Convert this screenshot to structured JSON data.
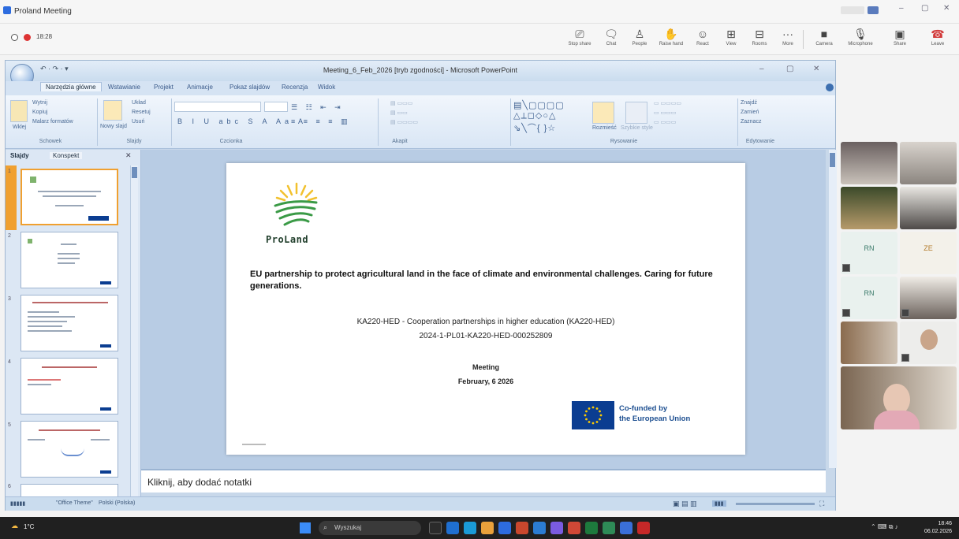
{
  "zoom": {
    "window_title": "Proland Meeting",
    "meeting_time": "18:28",
    "toolbar": [
      {
        "label": "Stop share",
        "icon": "share-icon"
      },
      {
        "label": "Chat",
        "icon": "chat-icon"
      },
      {
        "label": "People",
        "icon": "people-icon"
      },
      {
        "label": "Raise hand",
        "icon": "raise-hand-icon"
      },
      {
        "label": "React",
        "icon": "emoji-icon"
      },
      {
        "label": "View",
        "icon": "view-icon"
      },
      {
        "label": "Rooms",
        "icon": "rooms-icon"
      },
      {
        "label": "More",
        "icon": "more-icon"
      },
      {
        "label": "Camera",
        "icon": "camera-icon"
      },
      {
        "label": "Microphone",
        "icon": "mic-icon"
      },
      {
        "label": "Share",
        "icon": "share-screen-icon"
      },
      {
        "label": "Leave",
        "icon": "phone-hangup-icon"
      }
    ]
  },
  "ppt": {
    "title": "Meeting_6_Feb_2026 [tryb zgodności] - Microsoft PowerPoint",
    "tabs": [
      "Narzędzia główne",
      "Wstawianie",
      "Projekt",
      "Animacje",
      "Pokaz slajdów",
      "Recenzja",
      "Widok"
    ],
    "ribbon_groups": [
      "Schowek",
      "Slajdy",
      "Czcionka",
      "Akapit",
      "Rysowanie",
      "Edytowanie"
    ],
    "ribbon": {
      "paste": "Wklej",
      "cut": "Wytnij",
      "copy": "Kopiuj",
      "format_painter": "Malarz formatów",
      "new_slide": "Nowy slajd",
      "layout": "Układ",
      "reset": "Resetuj",
      "delete": "Usuń",
      "arrange": "Rozmieść",
      "quick_styles": "Szybkie style",
      "find": "Znajdź",
      "replace": "Zamień",
      "select": "Zaznacz"
    },
    "pane_tabs": [
      "Slajdy",
      "Konspekt"
    ],
    "thumb_numbers": [
      "1",
      "2",
      "3",
      "4",
      "5",
      "6"
    ],
    "notes_placeholder": "Kliknij, aby dodać notatki",
    "status": {
      "theme": "\"Office Theme\"",
      "language": "Polski (Polska)"
    }
  },
  "slide": {
    "logo_text": "ProLand",
    "title": "EU partnership to protect agricultural land in the face of climate and environmental challenges. Caring for future generations.",
    "programme": "KA220-HED - Cooperation partnerships in higher education (KA220-HED)",
    "project_number": "2024-1-PL01-KA220-HED-000252809",
    "meeting": "Meeting",
    "date": "February, 6 2026",
    "eu_line1": "Co-funded by",
    "eu_line2": "the European Union"
  },
  "participants": [
    {
      "initials": "RN"
    },
    {
      "initials": "ZE"
    },
    {
      "initials": "RN"
    }
  ],
  "taskbar": {
    "weather_temp": "1°C",
    "search_placeholder": "Wyszukaj",
    "time": "18:46",
    "date": "06.02.2026"
  },
  "colors": {
    "eu_blue": "#0b3d91",
    "logo_green": "#3a9a46",
    "logo_yellow": "#f2c12e",
    "ribbon_blue": "#d9e6f5",
    "leave_red": "#d23b3b"
  }
}
